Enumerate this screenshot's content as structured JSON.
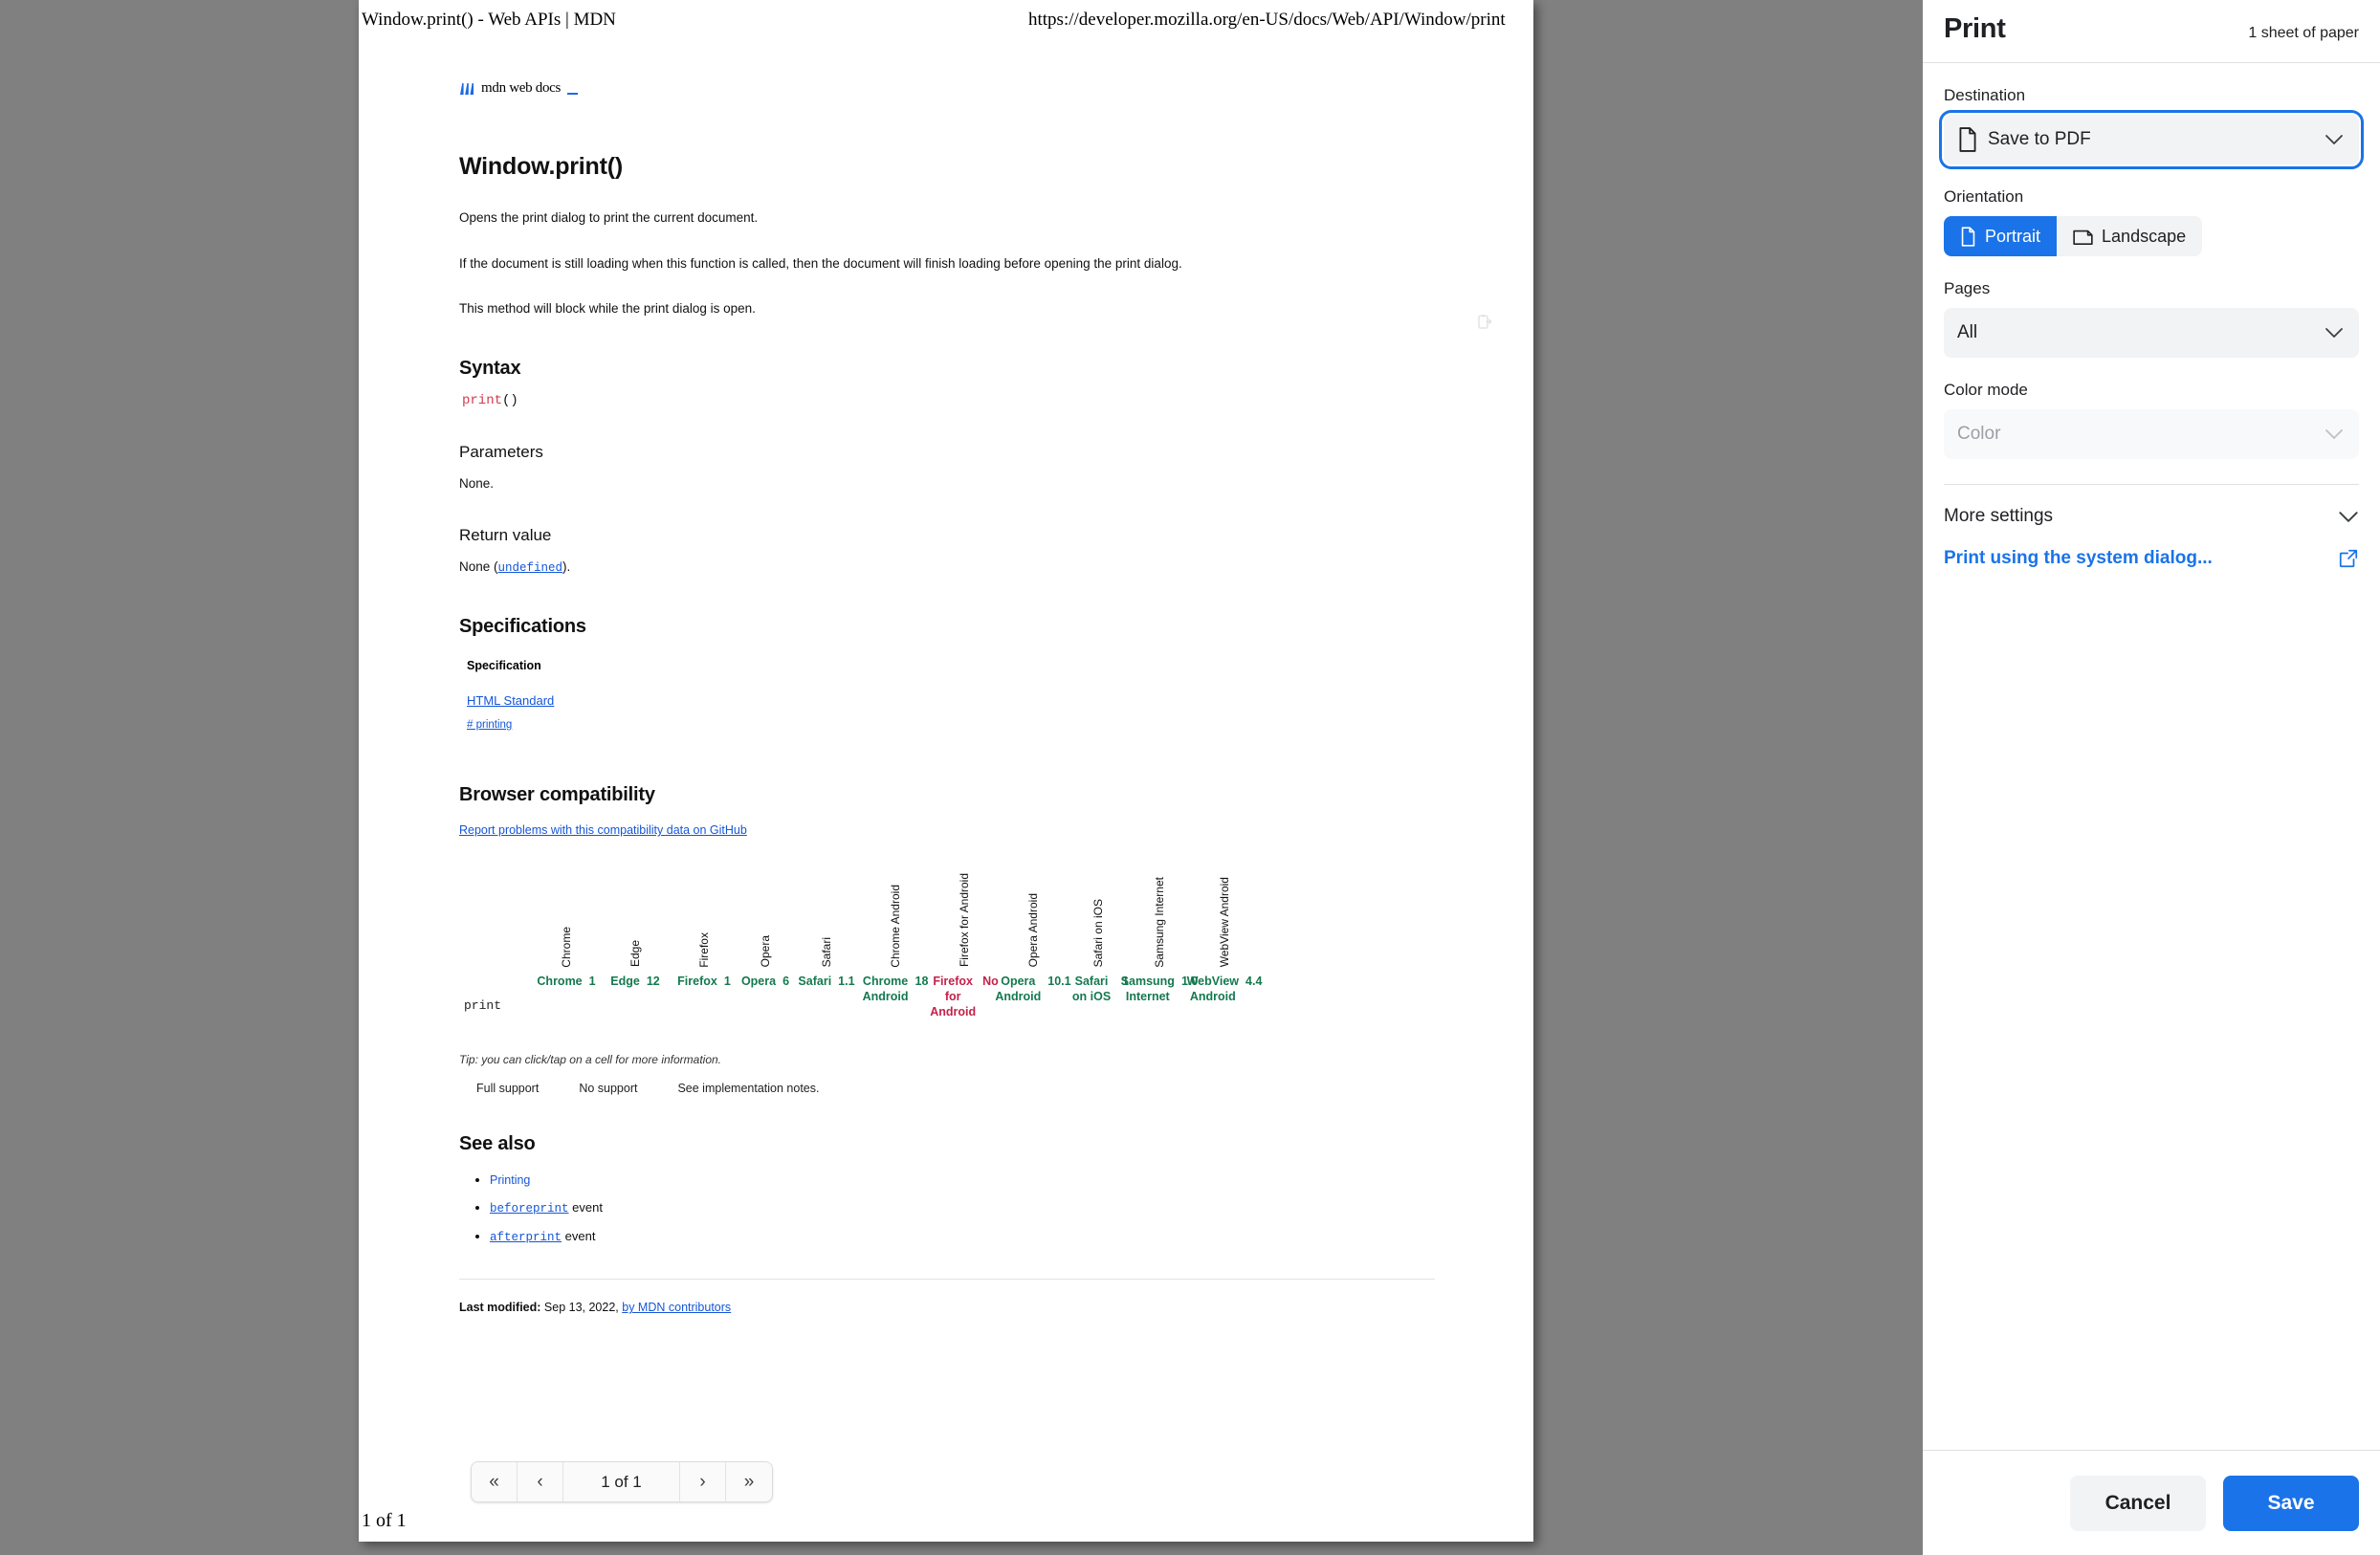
{
  "preview": {
    "page_header_left": "Window.print() - Web APIs | MDN",
    "page_header_right": "https://developer.mozilla.org/en-US/docs/Web/API/Window/print",
    "page_footer": "1 of 1",
    "logo_text": "mdn web docs",
    "doc": {
      "title": "Window.print()",
      "paragraphs": [
        "Opens the print dialog to print the current document.",
        "If the document is still loading when this function is called, then the document will finish loading before opening the print dialog.",
        "This method will block while the print dialog is open."
      ],
      "syntax_heading": "Syntax",
      "syntax_code_keyword": "print",
      "syntax_code_rest": "()",
      "parameters_heading": "Parameters",
      "parameters_value": "None.",
      "return_heading": "Return value",
      "return_prefix": "None (",
      "return_link": "undefined",
      "return_suffix": ").",
      "specifications_heading": "Specifications",
      "spec_table_header": "Specification",
      "spec_link": "HTML Standard",
      "spec_anchor": "# printing",
      "browser_compat_heading": "Browser compatibility",
      "report_link": "Report problems with this compatibility data on GitHub",
      "compat_row_label": "print",
      "tip": "Tip: you can click/tap on a cell for more information.",
      "legend": [
        "Full support",
        "No support",
        "See implementation notes."
      ],
      "see_also_heading": "See also",
      "see_also": [
        {
          "link": "Printing",
          "suffix": "",
          "code": false
        },
        {
          "link": "beforeprint",
          "suffix": " event",
          "code": true
        },
        {
          "link": "afterprint",
          "suffix": " event",
          "code": true
        }
      ],
      "last_modified_label": "Last modified:",
      "last_modified_date": "Sep 13, 2022,",
      "contributors_link": "by MDN contributors"
    },
    "compat_columns": [
      {
        "header": "Chrome",
        "name": "Chrome",
        "version": "1",
        "supported": true
      },
      {
        "header": "Edge",
        "name": "Edge",
        "version": "12",
        "supported": true
      },
      {
        "header": "Firefox",
        "name": "Firefox",
        "version": "1",
        "supported": true
      },
      {
        "header": "Opera",
        "name": "Opera",
        "version": "6",
        "supported": true
      },
      {
        "header": "Safari",
        "name": "Safari",
        "version": "1.1",
        "supported": true
      },
      {
        "header": "Chrome Android",
        "name": "Chrome Android",
        "version": "18",
        "supported": true
      },
      {
        "header": "Firefox for Android",
        "name": "Firefox for Android",
        "version": "No",
        "supported": false
      },
      {
        "header": "Opera Android",
        "name": "Opera Android",
        "version": "10.1",
        "supported": true
      },
      {
        "header": "Safari on iOS",
        "name": "Safari on iOS",
        "version": "1",
        "supported": true
      },
      {
        "header": "Samsung Internet",
        "name": "Samsung Internet",
        "version": "1.0",
        "supported": true
      },
      {
        "header": "WebView Android",
        "name": "WebView Android",
        "version": "4.4",
        "supported": true
      }
    ],
    "page_nav": {
      "first_label": "«",
      "prev_label": "‹",
      "page_indicator": "1 of 1",
      "next_label": "›",
      "last_label": "»"
    }
  },
  "sidebar": {
    "title": "Print",
    "sheets": "1 sheet of paper",
    "destination": {
      "label": "Destination",
      "value": "Save to PDF"
    },
    "orientation": {
      "label": "Orientation",
      "portrait": "Portrait",
      "landscape": "Landscape",
      "selected": "Portrait"
    },
    "pages": {
      "label": "Pages",
      "value": "All"
    },
    "color_mode": {
      "label": "Color mode",
      "value": "Color"
    },
    "more_settings": "More settings",
    "system_dialog": "Print using the system dialog...",
    "cancel": "Cancel",
    "save": "Save"
  },
  "colors": {
    "accent_blue": "#1a73e8",
    "link_blue": "#1456d8",
    "support_green": "#14794f",
    "no_support_red": "#c4224a",
    "page_backdrop": "#808080"
  }
}
